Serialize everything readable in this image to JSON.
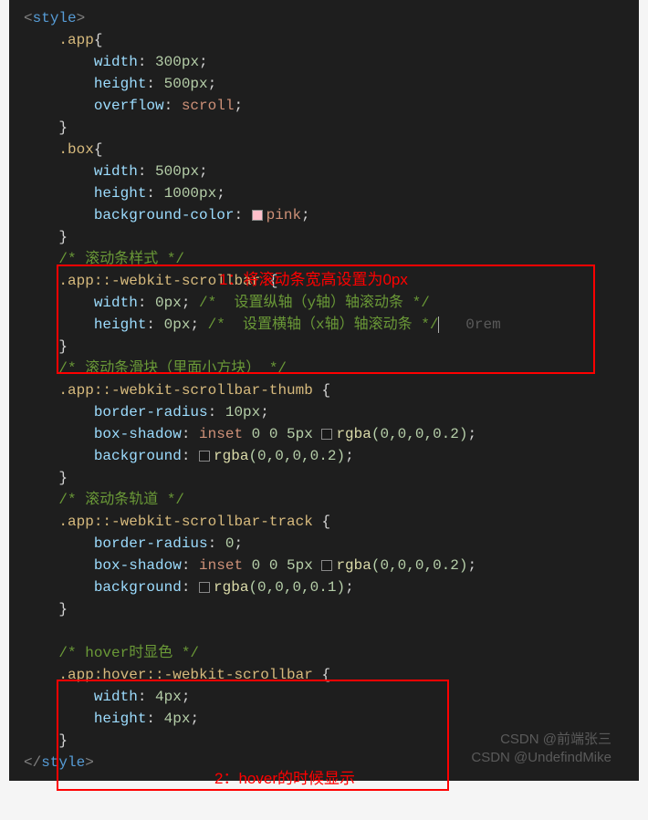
{
  "code": {
    "l1": {
      "open": "<",
      "style": "style",
      "close": ">"
    },
    "l2": {
      "sel": ".app",
      "br": "{"
    },
    "l3": {
      "prop": "width",
      "colon": ": ",
      "val": "300px",
      "semi": ";"
    },
    "l4": {
      "prop": "height",
      "colon": ": ",
      "val": "500px",
      "semi": ";"
    },
    "l5": {
      "prop": "overflow",
      "colon": ": ",
      "val": "scroll",
      "semi": ";"
    },
    "l6": {
      "br": "}"
    },
    "l7": {
      "sel": ".box",
      "br": "{"
    },
    "l8": {
      "prop": "width",
      "colon": ": ",
      "val": "500px",
      "semi": ";"
    },
    "l9": {
      "prop": "height",
      "colon": ": ",
      "val": "1000px",
      "semi": ";"
    },
    "l10": {
      "prop": "background-color",
      "colon": ": ",
      "swatch": "#ffc0cb",
      "val": "pink",
      "semi": ";"
    },
    "l11": {
      "br": "}"
    },
    "l12": {
      "comment": "/* 滚动条样式 */"
    },
    "l13": {
      "sel": ".app::-webkit-scrollbar ",
      "br": "{"
    },
    "l14": {
      "prop": "width",
      "colon": ": ",
      "val": "0px",
      "semi": "; ",
      "comment": "/*  设置纵轴（y轴）轴滚动条 */"
    },
    "l15": {
      "prop": "height",
      "colon": ": ",
      "val": "0px",
      "semi": "; ",
      "comment": "/*  设置横轴（x轴）轴滚动条 */",
      "hint": "   0rem"
    },
    "l16": {
      "br": "}"
    },
    "l17": {
      "comment": "/* 滚动条滑块（里面小方块） */"
    },
    "l18": {
      "sel": ".app::-webkit-scrollbar-thumb ",
      "br": "{"
    },
    "l19": {
      "prop": "border-radius",
      "colon": ": ",
      "val": "10px",
      "semi": ";"
    },
    "l20": {
      "prop": "box-shadow",
      "colon": ": ",
      "kw": "inset ",
      "nums": "0 0 5px ",
      "swatch": "rgba(0,0,0,0.2)",
      "fn": "rgba",
      "args": "(0,0,0,0.2)",
      "semi": ";"
    },
    "l21": {
      "prop": "background",
      "colon": ": ",
      "swatch": "rgba(0,0,0,0.2)",
      "fn": "rgba",
      "args": "(0,0,0,0.2)",
      "semi": ";"
    },
    "l22": {
      "br": "}"
    },
    "l23": {
      "comment": "/* 滚动条轨道 */"
    },
    "l24": {
      "sel": ".app::-webkit-scrollbar-track ",
      "br": "{"
    },
    "l25": {
      "prop": "border-radius",
      "colon": ": ",
      "val": "0",
      "semi": ";"
    },
    "l26": {
      "prop": "box-shadow",
      "colon": ": ",
      "kw": "inset ",
      "nums": "0 0 5px ",
      "swatch": "rgba(0,0,0,0.2)",
      "fn": "rgba",
      "args": "(0,0,0,0.2)",
      "semi": ";"
    },
    "l27": {
      "prop": "background",
      "colon": ": ",
      "swatch": "rgba(0,0,0,0.1)",
      "fn": "rgba",
      "args": "(0,0,0,0.1)",
      "semi": ";"
    },
    "l28": {
      "br": "}"
    },
    "l30": {
      "comment": "/* hover时显色 */"
    },
    "l31": {
      "sel": ".app:hover::-webkit-scrollbar ",
      "br": "{"
    },
    "l32": {
      "prop": "width",
      "colon": ": ",
      "val": "4px",
      "semi": ";"
    },
    "l33": {
      "prop": "height",
      "colon": ": ",
      "val": "4px",
      "semi": ";"
    },
    "l34": {
      "br": "}"
    },
    "l35": {
      "open": "</",
      "style": "style",
      "close": ">"
    }
  },
  "annotations": {
    "a1": "1：将滚动条宽高设置为0px",
    "a2": "2：hover的时候显示"
  },
  "watermark": {
    "w1": "CSDN @前端张三",
    "w2": "CSDN @UndefindMike"
  }
}
